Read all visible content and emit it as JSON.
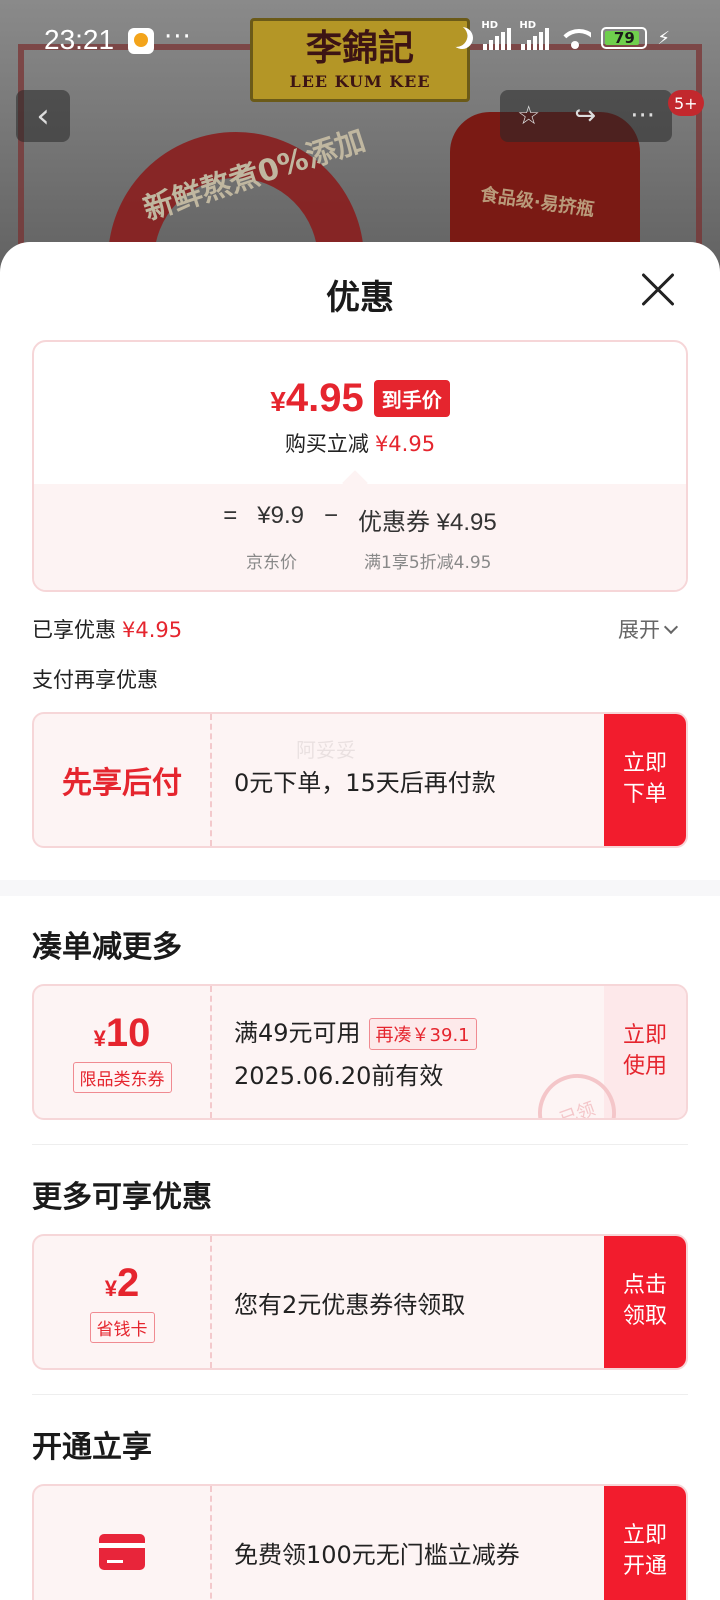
{
  "status_bar": {
    "time": "23:21",
    "dots": "···",
    "battery": "79",
    "hd1": "HD",
    "hd2": "HD"
  },
  "background": {
    "brand_cn": "李錦記",
    "brand_en": "LEE KUM KEE",
    "arc_text": "新鲜熬煮0%添加",
    "bottle_text": "食品级·易挤瓶"
  },
  "nav": {
    "badge": "5+"
  },
  "sheet": {
    "title": "优惠",
    "price": {
      "final": "4.95",
      "yen": "¥",
      "final_tag": "到手价",
      "reduce_label": "购买立减",
      "reduce_value": "¥4.95",
      "eq": "=",
      "jd_price": "¥9.9",
      "minus": "−",
      "coupon": "优惠券 ¥4.95",
      "jd_price_label": "京东价",
      "coupon_rule": "满1享5折减4.95"
    },
    "enjoyed_label": "已享优惠",
    "enjoyed_value": "¥4.95",
    "expand": "展开",
    "pay_more": "支付再享优惠",
    "bnpl": {
      "left": "先享后付",
      "text": "0元下单，15天后再付款",
      "button": "立即\n下单",
      "watermark": "阿妥妥"
    },
    "section1": "凑单减更多",
    "coupon1": {
      "amount": "10",
      "yen": "¥",
      "tag": "限品类东券",
      "cond": "满49元可用",
      "add": "再凑￥39.1",
      "expire": "2025.06.20前有效",
      "button": "立即\n使用",
      "stamp": "已领"
    },
    "section2": "更多可享优惠",
    "coupon2": {
      "amount": "2",
      "yen": "¥",
      "tag": "省钱卡",
      "text": "您有2元优惠券待领取",
      "button": "点击\n领取"
    },
    "section3": "开通立享",
    "coupon3": {
      "text": "免费领100元无门槛立减券",
      "button": "立即\n开通"
    }
  },
  "colors": {
    "accent": "#e5252e",
    "button": "#f21c2d"
  }
}
